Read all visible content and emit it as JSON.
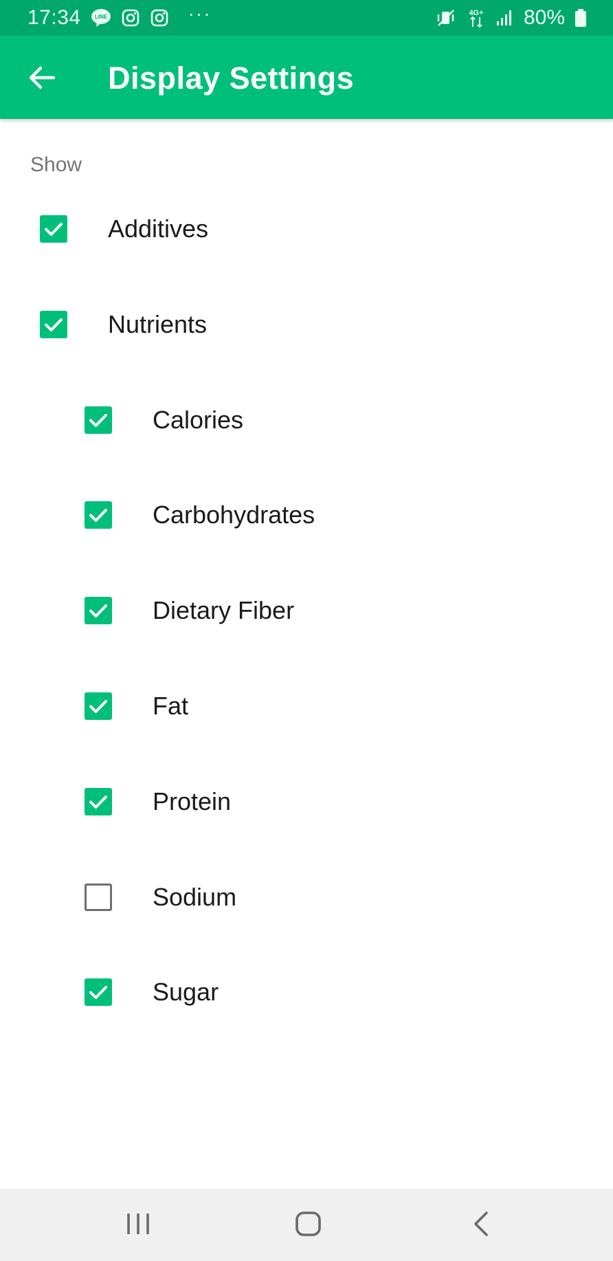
{
  "status_bar": {
    "time": "17:34",
    "left_icons": [
      "line-icon",
      "instagram-icon",
      "instagram-icon"
    ],
    "more": "···",
    "right_icons": [
      "mute-vibrate-icon",
      "4g-data-icon",
      "signal-icon",
      "battery-icon"
    ],
    "network_label": "4G+",
    "battery": "80%"
  },
  "app_bar": {
    "title": "Display Settings",
    "back_icon": "arrow-back-icon"
  },
  "section": {
    "label": "Show"
  },
  "items": [
    {
      "label": "Additives",
      "checked": true,
      "level": 0
    },
    {
      "label": "Nutrients",
      "checked": true,
      "level": 0
    },
    {
      "label": "Calories",
      "checked": true,
      "level": 1
    },
    {
      "label": "Carbohydrates",
      "checked": true,
      "level": 1
    },
    {
      "label": "Dietary Fiber",
      "checked": true,
      "level": 1
    },
    {
      "label": "Fat",
      "checked": true,
      "level": 1
    },
    {
      "label": "Protein",
      "checked": true,
      "level": 1
    },
    {
      "label": "Sodium",
      "checked": false,
      "level": 1
    },
    {
      "label": "Sugar",
      "checked": true,
      "level": 1
    }
  ],
  "nav_bar": {
    "icons": [
      "recent-apps-icon",
      "home-icon",
      "back-icon"
    ]
  },
  "colors": {
    "status_bar": "#00a86b",
    "accent": "#00bf7a",
    "unchecked_border": "#6e6e6e",
    "nav_bar": "#f0f0f0"
  }
}
